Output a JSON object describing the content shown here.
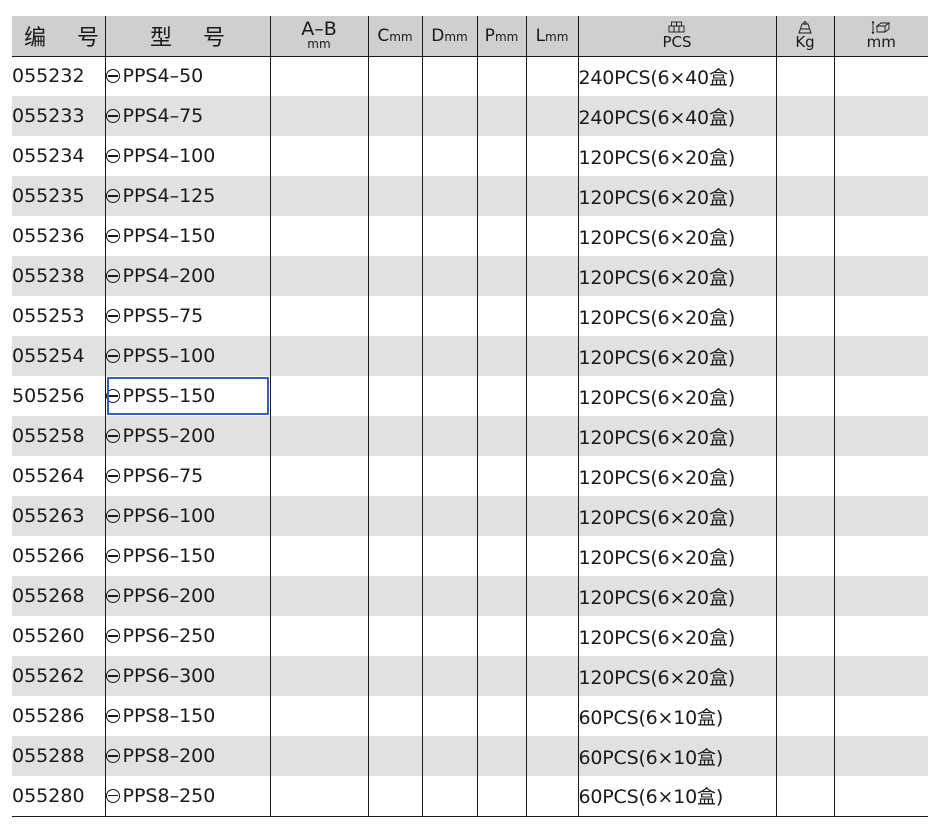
{
  "headers": {
    "code": "编 号",
    "model": "型 号",
    "ab_top": "A–B",
    "ab_unit": "mm",
    "c_letter": "C",
    "c_unit": "mm",
    "d_letter": "D",
    "d_unit": "mm",
    "p_letter": "P",
    "p_unit": "mm",
    "l_letter": "L",
    "l_unit": "mm",
    "pcs_label": "PCS",
    "kg_label": "Kg",
    "box_label": "mm"
  },
  "icons": {
    "pcs": "stacked-boxes-icon",
    "kg": "weight-scale-icon",
    "box": "box-dimension-icon",
    "slot": "slotted-tip-icon"
  },
  "colors": {
    "header_bg": "#cfcfcf",
    "stripe_bg": "#e1e1e1",
    "selection_border": "#3560b5"
  },
  "rows": [
    {
      "code": "055232",
      "model": "PPS4–50",
      "pack": "240PCS(6×40盒)"
    },
    {
      "code": "055233",
      "model": "PPS4–75",
      "pack": "240PCS(6×40盒)"
    },
    {
      "code": "055234",
      "model": "PPS4–100",
      "pack": "120PCS(6×20盒)"
    },
    {
      "code": "055235",
      "model": "PPS4–125",
      "pack": "120PCS(6×20盒)"
    },
    {
      "code": "055236",
      "model": "PPS4–150",
      "pack": "120PCS(6×20盒)"
    },
    {
      "code": "055238",
      "model": "PPS4–200",
      "pack": "120PCS(6×20盒)"
    },
    {
      "code": "055253",
      "model": "PPS5–75",
      "pack": "120PCS(6×20盒)"
    },
    {
      "code": "055254",
      "model": "PPS5–100",
      "pack": "120PCS(6×20盒)"
    },
    {
      "code": "505256",
      "model": "PPS5–150",
      "pack": "120PCS(6×20盒)",
      "selected": true
    },
    {
      "code": "055258",
      "model": "PPS5–200",
      "pack": "120PCS(6×20盒)"
    },
    {
      "code": "055264",
      "model": "PPS6–75",
      "pack": "120PCS(6×20盒)"
    },
    {
      "code": "055263",
      "model": "PPS6–100",
      "pack": "120PCS(6×20盒)"
    },
    {
      "code": "055266",
      "model": "PPS6–150",
      "pack": "120PCS(6×20盒)"
    },
    {
      "code": "055268",
      "model": "PPS6–200",
      "pack": "120PCS(6×20盒)"
    },
    {
      "code": "055260",
      "model": "PPS6–250",
      "pack": "120PCS(6×20盒)"
    },
    {
      "code": "055262",
      "model": "PPS6–300",
      "pack": "120PCS(6×20盒)"
    },
    {
      "code": "055286",
      "model": "PPS8–150",
      "pack": "60PCS(6×10盒)"
    },
    {
      "code": "055288",
      "model": "PPS8–200",
      "pack": "60PCS(6×10盒)"
    },
    {
      "code": "055280",
      "model": "PPS8–250",
      "pack": "60PCS(6×10盒)"
    }
  ]
}
